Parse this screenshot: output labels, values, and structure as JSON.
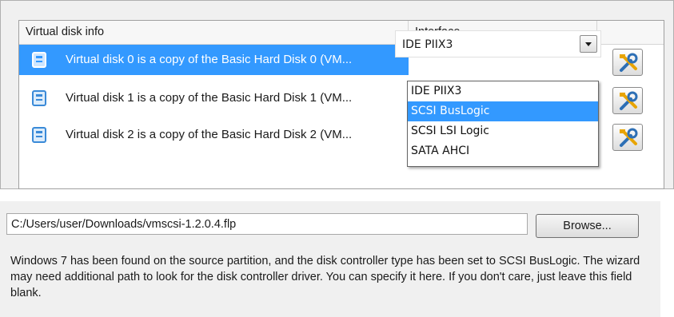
{
  "table": {
    "header_disk_info": "Virtual disk info",
    "header_interface": "Interface",
    "rows": [
      {
        "label": "Virtual disk 0 is a copy of the Basic Hard Disk 0 (VM..."
      },
      {
        "label": "Virtual disk 1 is a copy of the Basic Hard Disk 1 (VM..."
      },
      {
        "label": "Virtual disk 2 is a copy of the Basic Hard Disk 2 (VM..."
      }
    ]
  },
  "interface_select": {
    "value": "IDE PIIX3",
    "options": [
      "IDE PIIX3",
      "SCSI BusLogic",
      "SCSI LSI Logic",
      "SATA AHCI"
    ],
    "highlighted": "SCSI BusLogic"
  },
  "driver_path": {
    "value": "C:/Users/user/Downloads/vmscsi-1.2.0.4.flp",
    "browse_label": "Browse..."
  },
  "info_text": "Windows 7 has been found on the source partition, and the disk controller type has been set to SCSI BusLogic. The wizard may need additional path to look for the disk controller driver. You can specify it here. If you don't care, just leave this field blank.",
  "icons": [
    "disk-icon",
    "tools-icon",
    "chevron-down-icon"
  ],
  "colors": {
    "selection": "#3399ff",
    "panel_bg": "#f0f0f0"
  }
}
